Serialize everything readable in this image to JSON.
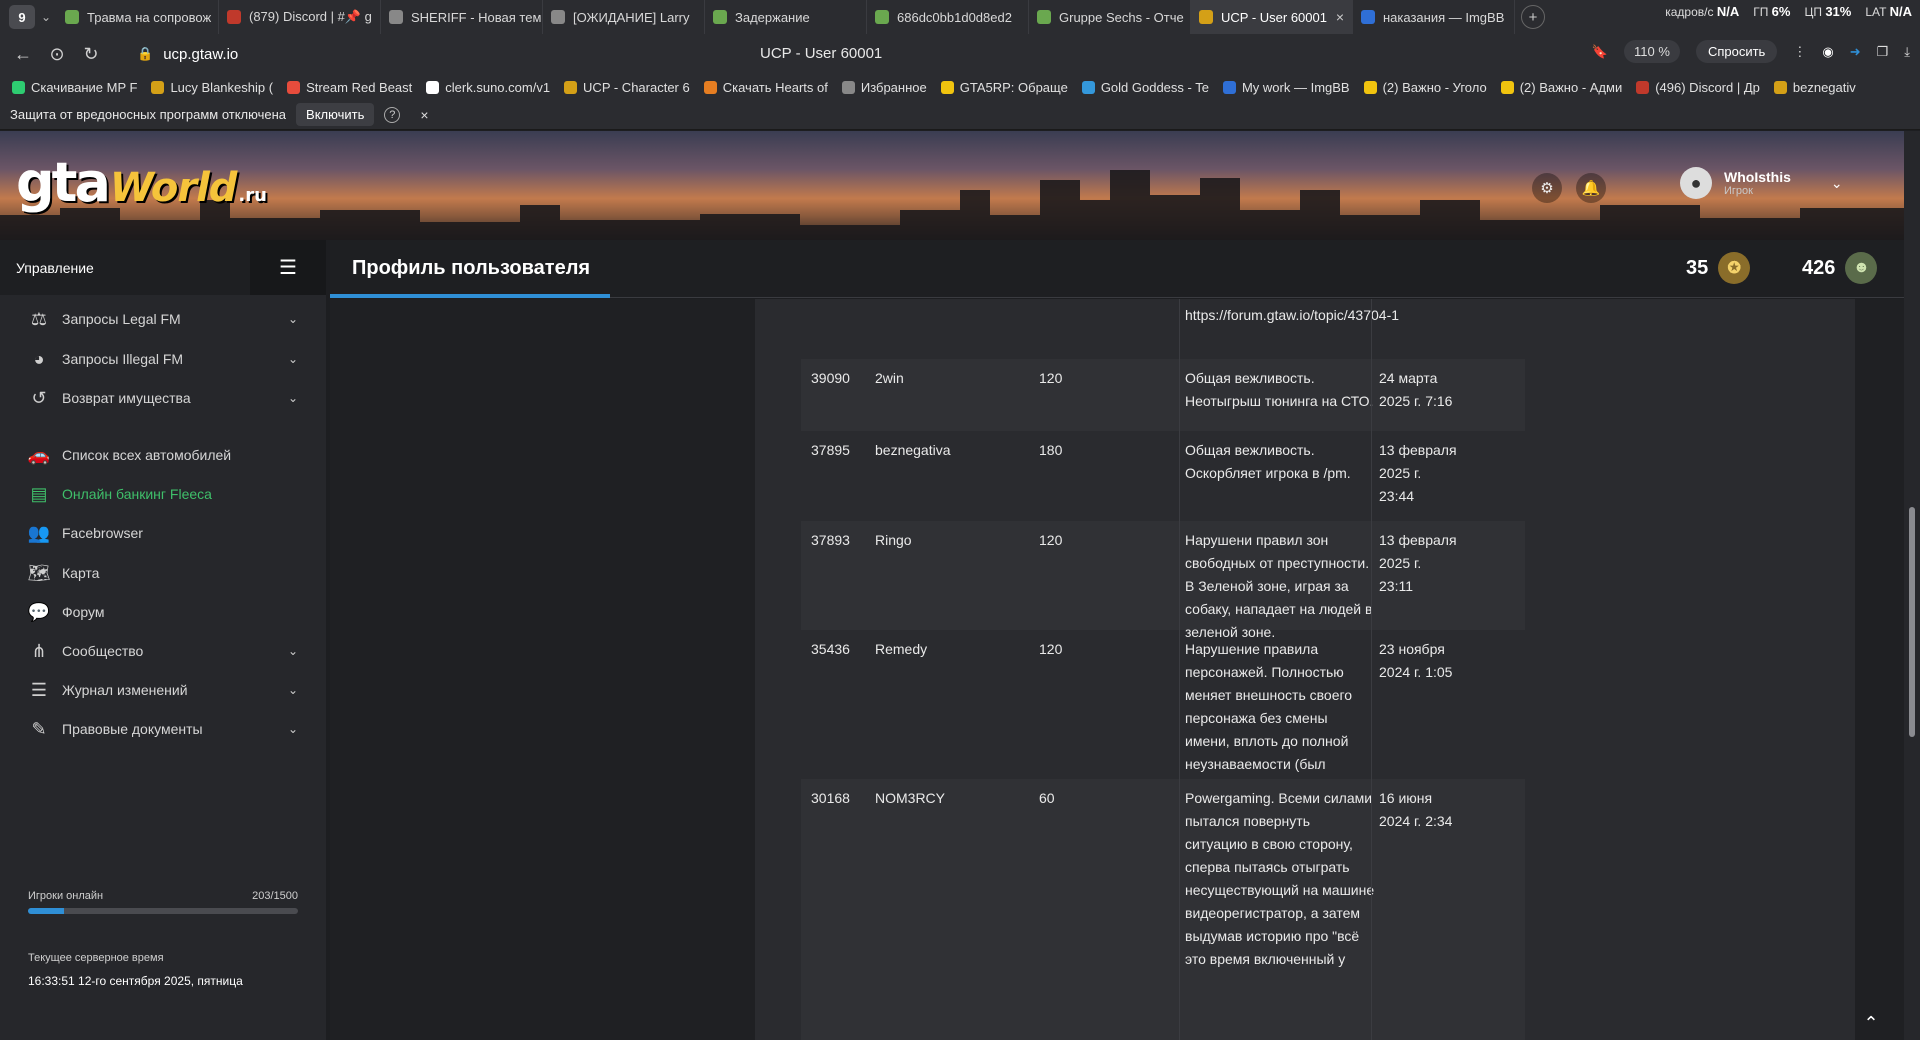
{
  "browser": {
    "tab_count": "9",
    "tabs": [
      {
        "title": "Травма на сопровож",
        "color": "#6aa84f"
      },
      {
        "title": "(879) Discord | #📌 g",
        "color": "#c0392b"
      },
      {
        "title": "SHERIFF - Новая тем",
        "color": "#888888"
      },
      {
        "title": "[ОЖИДАНИЕ] Larry",
        "color": "#888888"
      },
      {
        "title": "Задержание",
        "color": "#6aa84f"
      },
      {
        "title": "686dc0bb1d0d8ed2",
        "color": "#6aa84f"
      },
      {
        "title": "Gruppe Sechs - Отче",
        "color": "#6aa84f"
      },
      {
        "title": "UCP - User 60001",
        "color": "#d4a017"
      },
      {
        "title": "наказания — ImgBB",
        "color": "#2f6fd6"
      }
    ],
    "active_tab": 7,
    "new_tab": "+",
    "hw": {
      "personnel": "кадров/с",
      "personnel_val": "N/A",
      "gpu": "ГП",
      "gpu_val": "6%",
      "cpu": "ЦП",
      "cpu_val": "31%",
      "lat": "LAT",
      "lat_val": "N/A"
    },
    "url": "ucp.gtaw.io",
    "page_title": "UCP - User 60001",
    "zoom": "110 %",
    "ask": "Спросить",
    "bookmarks": [
      {
        "label": "Скачивание MP F",
        "color": "#2ecc71"
      },
      {
        "label": "Lucy Blankeship (",
        "color": "#d4a017"
      },
      {
        "label": "Stream Red Beast",
        "color": "#e74c3c"
      },
      {
        "label": "clerk.suno.com/v1",
        "color": "#ffffff"
      },
      {
        "label": "UCP - Character 6",
        "color": "#d4a017"
      },
      {
        "label": "Скачать Hearts of",
        "color": "#e67e22"
      },
      {
        "label": "Избранное",
        "color": "#888888"
      },
      {
        "label": "GTA5RP: Обраще",
        "color": "#f1c40f"
      },
      {
        "label": "Gold Goddess - Te",
        "color": "#3498db"
      },
      {
        "label": "My work — ImgBB",
        "color": "#2f6fd6"
      },
      {
        "label": "(2) Важно - Уголо",
        "color": "#f1c40f"
      },
      {
        "label": "(2) Важно - Адми",
        "color": "#f1c40f"
      },
      {
        "label": "(496) Discord | Др",
        "color": "#c0392b"
      },
      {
        "label": "beznegativ",
        "color": "#d4a017"
      }
    ],
    "warning": {
      "text": "Защита от вредоносных программ отключена",
      "button": "Включить",
      "help": "?",
      "close": "×"
    }
  },
  "site": {
    "logo_main": "gta",
    "logo_world": "World",
    "logo_ru": ".ru",
    "user": {
      "name": "WhoIsthis",
      "role": "Игрок"
    }
  },
  "sidebar": {
    "title": "Управление",
    "items": [
      {
        "label": "Запросы Legal FM",
        "icon": "⚖",
        "caret": true,
        "active": false
      },
      {
        "label": "Запросы Illegal FM",
        "icon": "◕",
        "caret": true,
        "active": false
      },
      {
        "label": "Возврат имущества",
        "icon": "↺",
        "caret": true,
        "active": false
      },
      {
        "label": "Список всех автомобилей",
        "icon": "🚗",
        "caret": false,
        "active": false
      },
      {
        "label": "Онлайн банкинг Fleeca",
        "icon": "▤",
        "caret": false,
        "active": true
      },
      {
        "label": "Facebrowser",
        "icon": "👥",
        "caret": false,
        "active": false
      },
      {
        "label": "Карта",
        "icon": "🗺",
        "caret": false,
        "active": false
      },
      {
        "label": "Форум",
        "icon": "💬",
        "caret": false,
        "active": false
      },
      {
        "label": "Сообщество",
        "icon": "⋔",
        "caret": true,
        "active": false
      },
      {
        "label": "Журнал изменений",
        "icon": "☰",
        "caret": true,
        "active": false
      },
      {
        "label": "Правовые документы",
        "icon": "✎",
        "caret": true,
        "active": false
      }
    ],
    "online": {
      "label": "Игроки онлайн",
      "value": "203/1500",
      "fraction": 0.135
    },
    "server_time": {
      "label": "Текущее серверное время",
      "value": "16:33:51 12-го сентября 2025, пятница"
    }
  },
  "main": {
    "title": "Профиль пользователя",
    "stat1": "35",
    "stat2": "426"
  },
  "table": {
    "partial_reason": "https://forum.gtaw.io/topic/43704-1",
    "rows": [
      {
        "id": "39090",
        "admin": "2win",
        "minutes": "120",
        "reason": "Общая вежливость. Неотыгрыш тюнинга на СТО.",
        "date": "24 марта 2025 г. 7:16"
      },
      {
        "id": "37895",
        "admin": "beznegativa",
        "minutes": "180",
        "reason": "Общая вежливость. Оскорбляет игрока в /pm.",
        "date": "13 февраля 2025 г. 23:44"
      },
      {
        "id": "37893",
        "admin": "Ringo",
        "minutes": "120",
        "reason": "Нарушени правил зон свободных от преступности. В Зеленой зоне, играя за собаку, нападает на людей в зеленой зоне.",
        "date": "13 февраля 2025 г. 23:11"
      },
      {
        "id": "35436",
        "admin": "Remedy",
        "minutes": "120",
        "reason": "Нарушение правила персонажей. Полностью меняет внешность своего персонажа без смены имени, вплоть до полной неузнаваемости (был черный цвет кожи - стал белым). + CK",
        "date": "23 ноября 2024 г. 1:05"
      },
      {
        "id": "30168",
        "admin": "NOM3RCY",
        "minutes": "60",
        "reason": "Powergaming. Всеми силами пытался повернуть ситуацию в свою сторону, сперва пытаясь отыграть несуществующий на машине видеорегистратор, а затем выдумав историю про \"всё это время включенный у",
        "date": "16 июня 2024 г. 2:34"
      }
    ]
  }
}
